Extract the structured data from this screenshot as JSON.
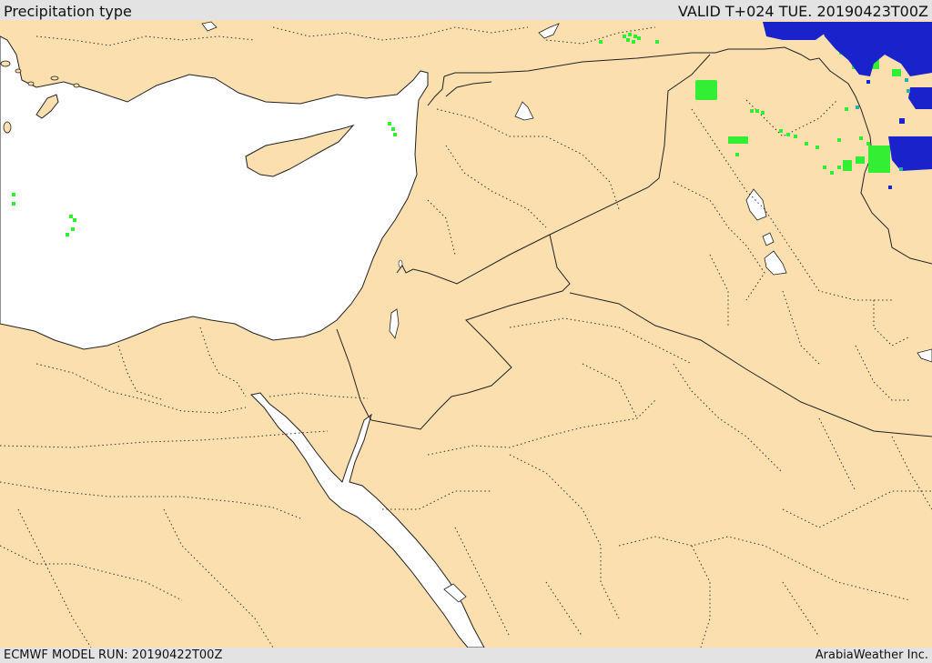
{
  "header": {
    "title": "Precipitation type",
    "valid": "VALID T+024 TUE. 20190423T00Z"
  },
  "footer": {
    "model_run": "ECMWF MODEL RUN: 20190422T00Z",
    "credit": "ArabiaWeather Inc."
  },
  "colors": {
    "land": "#fbdfae",
    "water": "#ffffff",
    "rain": "#33ee33",
    "snow": "#1a22cc",
    "mixed": "#33aaaa",
    "border": "#222222"
  }
}
